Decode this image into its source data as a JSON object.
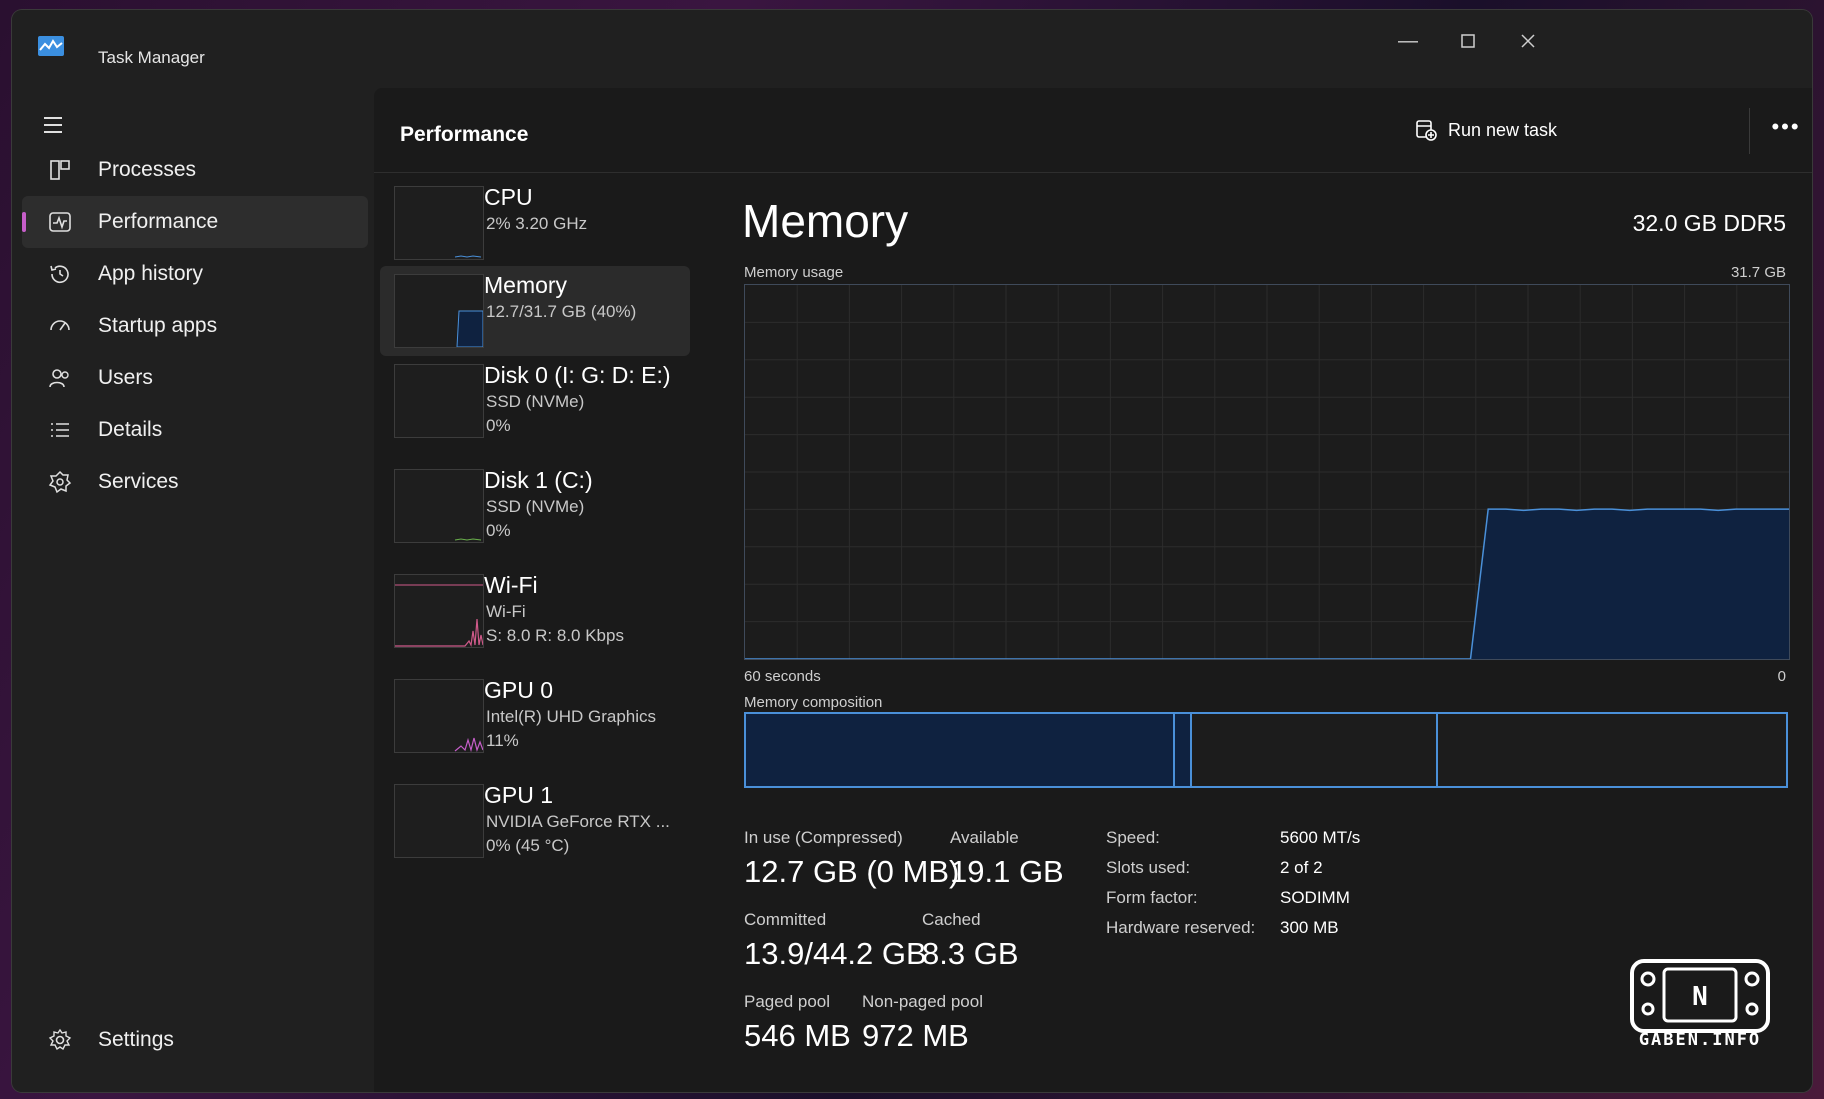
{
  "window": {
    "title": "Task Manager"
  },
  "sidebar": {
    "items": [
      {
        "label": "Processes",
        "icon": "processes-icon"
      },
      {
        "label": "Performance",
        "icon": "performance-icon",
        "active": true
      },
      {
        "label": "App history",
        "icon": "history-icon"
      },
      {
        "label": "Startup apps",
        "icon": "startup-icon"
      },
      {
        "label": "Users",
        "icon": "users-icon"
      },
      {
        "label": "Details",
        "icon": "details-icon"
      },
      {
        "label": "Services",
        "icon": "services-icon"
      }
    ],
    "settings_label": "Settings"
  },
  "header": {
    "title": "Performance",
    "run_task_label": "Run new task"
  },
  "devices": [
    {
      "name": "CPU",
      "line1": "2%  3.20 GHz",
      "line2": ""
    },
    {
      "name": "Memory",
      "line1": "12.7/31.7 GB (40%)",
      "line2": "",
      "active": true
    },
    {
      "name": "Disk 0 (I: G: D: E:)",
      "line1": "SSD (NVMe)",
      "line2": "0%"
    },
    {
      "name": "Disk 1 (C:)",
      "line1": "SSD (NVMe)",
      "line2": "0%"
    },
    {
      "name": "Wi-Fi",
      "line1": "Wi-Fi",
      "line2": "S: 8.0  R: 8.0 Kbps"
    },
    {
      "name": "GPU 0",
      "line1": "Intel(R) UHD Graphics",
      "line2": "11%"
    },
    {
      "name": "GPU 1",
      "line1": "NVIDIA GeForce RTX ...",
      "line2": "0%  (45 °C)"
    }
  ],
  "memory": {
    "title": "Memory",
    "spec": "32.0 GB DDR5",
    "usage_label": "Memory usage",
    "usage_max": "31.7 GB",
    "x_left": "60 seconds",
    "x_right": "0",
    "composition_label": "Memory composition",
    "stats": {
      "in_use_label": "In use (Compressed)",
      "in_use_value": "12.7 GB (0 MB)",
      "available_label": "Available",
      "available_value": "19.1 GB",
      "committed_label": "Committed",
      "committed_value": "13.9/44.2 GB",
      "cached_label": "Cached",
      "cached_value": "8.3 GB",
      "paged_label": "Paged pool",
      "paged_value": "546 MB",
      "nonpaged_label": "Non-paged pool",
      "nonpaged_value": "972 MB"
    },
    "props": {
      "speed_label": "Speed:",
      "speed_value": "5600 MT/s",
      "slots_label": "Slots used:",
      "slots_value": "2 of 2",
      "form_label": "Form factor:",
      "form_value": "SODIMM",
      "reserved_label": "Hardware reserved:",
      "reserved_value": "300 MB"
    },
    "usage_series_gb": [
      0,
      0,
      0,
      0,
      0,
      0,
      0,
      0,
      0,
      0,
      0,
      0,
      0,
      0,
      0,
      0,
      0,
      0,
      0,
      0,
      0,
      0,
      0,
      0,
      0,
      0,
      0,
      0,
      0,
      0,
      0,
      0,
      0,
      0,
      0,
      0,
      0,
      0,
      0,
      0,
      0,
      0,
      12.7,
      12.7,
      12.6,
      12.7,
      12.7,
      12.6,
      12.7,
      12.7,
      12.6,
      12.7,
      12.7,
      12.7,
      12.7,
      12.6,
      12.7,
      12.7,
      12.7,
      12.7
    ],
    "composition_gb": {
      "in_use": 12.7,
      "modified": 0.5,
      "standby": 7.3,
      "free": 10.3
    }
  },
  "colors": {
    "accent": "#c65ec9",
    "memory_line": "#4a90d9",
    "memory_fill": "#0f2240",
    "wifi": "#d05a8a"
  },
  "watermark": {
    "text": "GABEN.INFO"
  }
}
